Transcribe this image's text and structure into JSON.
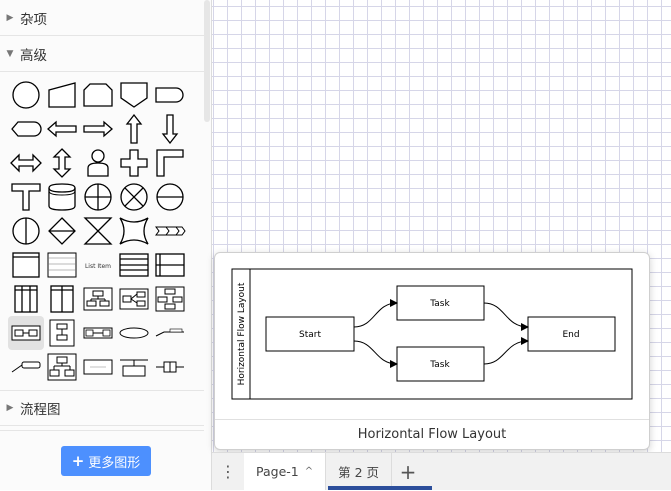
{
  "sidebar": {
    "sections": [
      {
        "label": "杂项",
        "expanded": false
      },
      {
        "label": "高级",
        "expanded": true
      },
      {
        "label": "流程图",
        "expanded": false
      }
    ],
    "more_shapes_label": "更多图形",
    "more_shapes_icon": "+",
    "shape_labels": {
      "list_item": "List Item"
    }
  },
  "popup": {
    "title": "Horizontal Flow Layout",
    "diagram": {
      "pool_label": "Horizontal Flow Layout",
      "start": "Start",
      "task_top": "Task",
      "task_bottom": "Task",
      "end": "End"
    }
  },
  "tabs": [
    {
      "label": "Page-1",
      "active": true,
      "chevron": "^"
    },
    {
      "label": "第 2 页",
      "active": false
    }
  ],
  "tabbar": {
    "menu_icon": "⋮",
    "add_icon": "+"
  },
  "colors": {
    "accent": "#4d90fe",
    "grid": "#d6d6e8"
  }
}
